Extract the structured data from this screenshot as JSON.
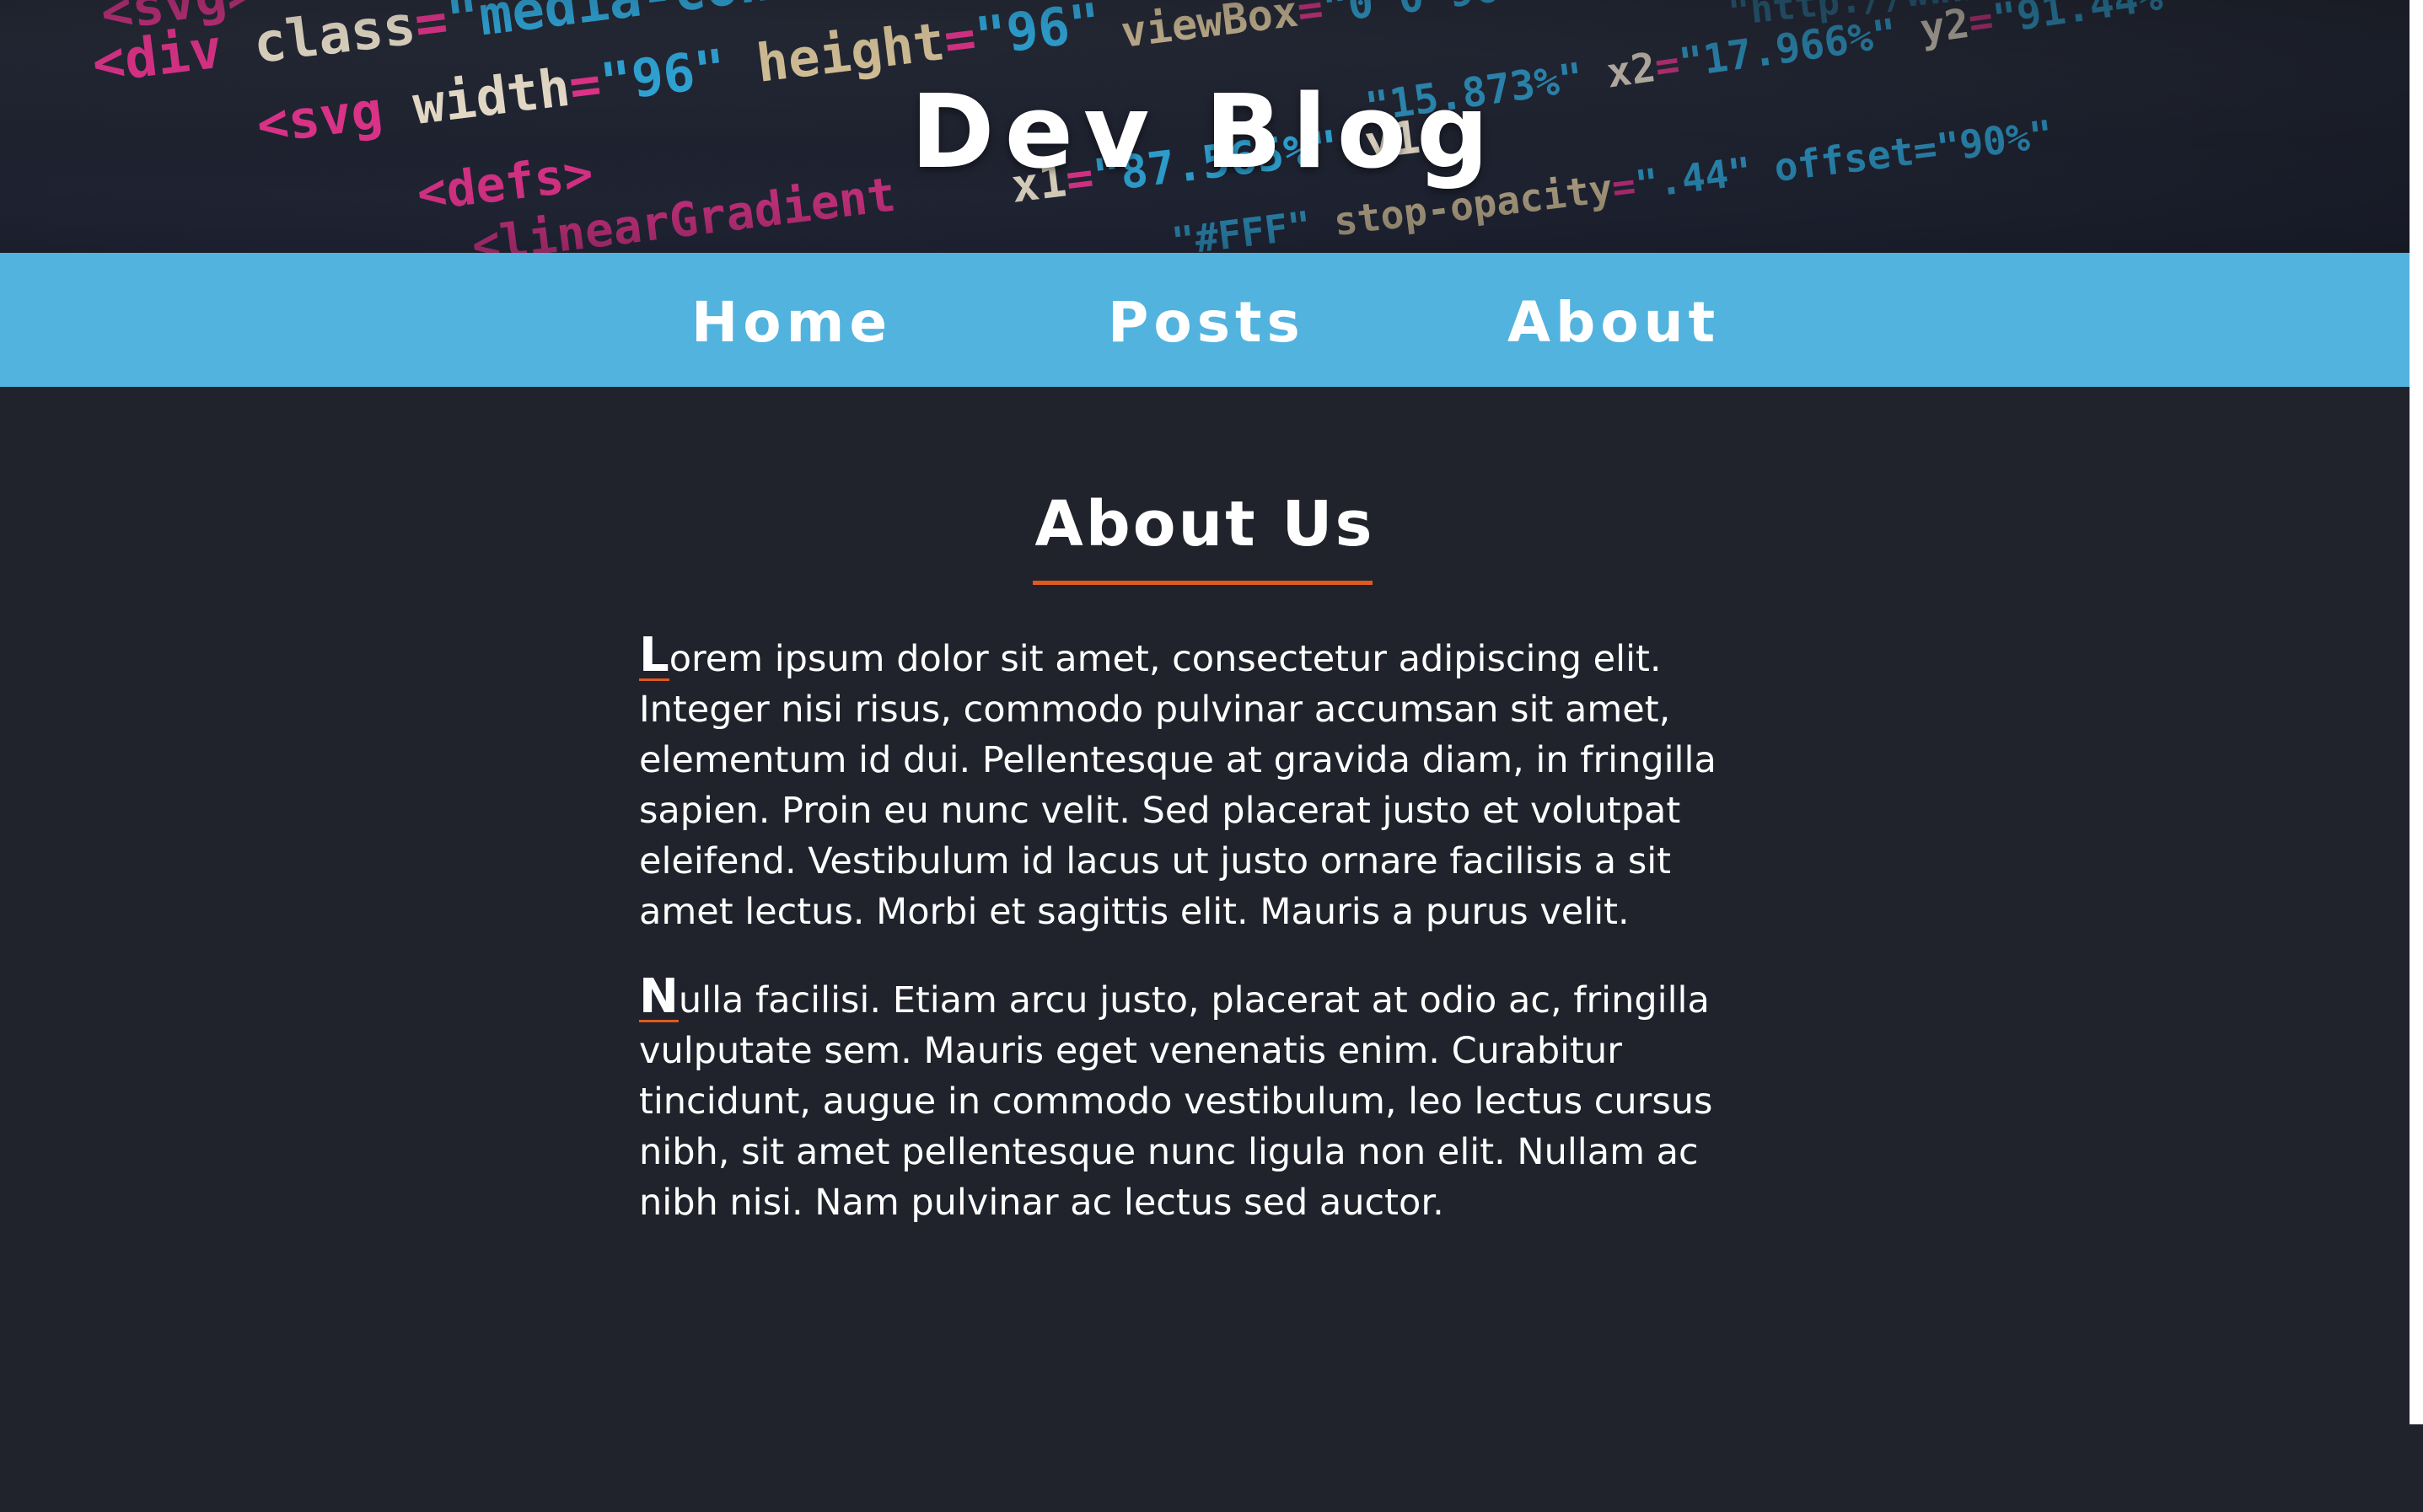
{
  "site": {
    "title": "Dev Blog"
  },
  "nav": {
    "items": [
      {
        "label": "Home"
      },
      {
        "label": "Posts"
      },
      {
        "label": "About"
      }
    ]
  },
  "about": {
    "heading": "About Us",
    "paragraphs": [
      {
        "initial": "L",
        "text": "orem ipsum dolor sit amet, consectetur adipiscing elit. Integer nisi risus, commodo pulvinar accumsan sit amet, elementum id dui. Pellentesque at gravida diam, in fringilla sapien. Proin eu nunc velit. Sed placerat justo et volutpat eleifend. Vestibulum id lacus ut justo ornare facilisis a sit amet lectus. Morbi et sagittis elit. Mauris a purus velit."
      },
      {
        "initial": "N",
        "text": "ulla facilisi. Etiam arcu justo, placerat at odio ac, fringilla vulputate sem. Mauris eget venenatis enim. Curabitur tincidunt, augue in commodo vestibulum, leo lectus cursus nibh, sit amet pellentesque nunc ligula non elit. Nullam ac nibh nisi. Nam pulvinar ac lectus sed auctor."
      }
    ]
  },
  "colors": {
    "nav_background": "#52b3de",
    "page_background": "#20232b",
    "accent": "#e05a1e",
    "text": "#ffffff"
  }
}
